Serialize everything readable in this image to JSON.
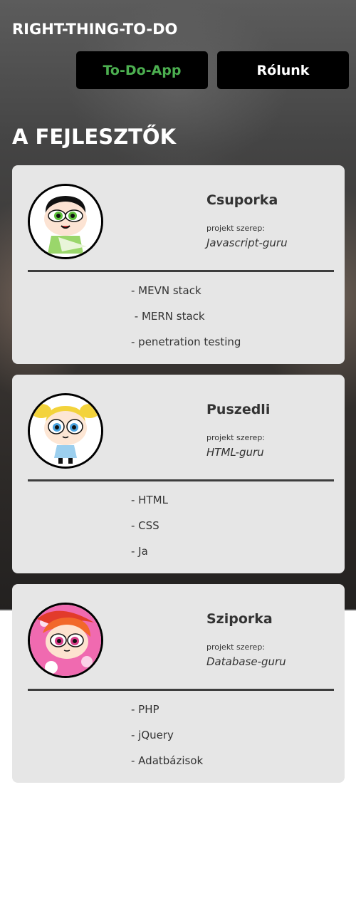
{
  "header": {
    "brand": "RIGHT-THING-TO-DO",
    "nav": [
      {
        "label": "To-Do-App"
      },
      {
        "label": "Rólunk"
      }
    ]
  },
  "section_title": "A FEJLESZTŐK",
  "role_caption": "projekt szerep:",
  "developers": [
    {
      "name": "Csuporka",
      "role": "Javascript-guru",
      "avatar": "buttercup-avatar",
      "skills": [
        "- MEVN stack",
        " - MERN stack",
        "- penetration testing"
      ]
    },
    {
      "name": "Puszedli",
      "role": "HTML-guru",
      "avatar": "bubbles-avatar",
      "skills": [
        "- HTML",
        "- CSS",
        "- Ja"
      ]
    },
    {
      "name": "Sziporka",
      "role": "Database-guru",
      "avatar": "blossom-avatar",
      "skills": [
        "- PHP",
        "- jQuery",
        "- Adatbázisok"
      ]
    }
  ],
  "colors": {
    "nav_active_text": "#4caf50",
    "nav_bg": "#000000",
    "card_bg": "#e6e6e6",
    "divider": "#3d3d3d"
  }
}
